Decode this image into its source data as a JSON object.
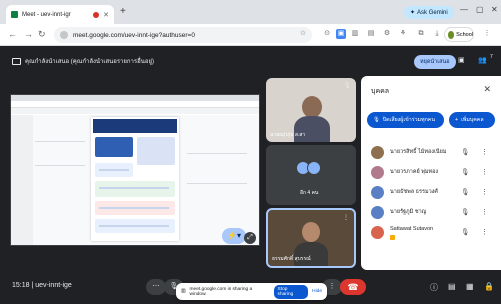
{
  "browser": {
    "tab_title": "Meet - uev-innt-igr",
    "new_tab": "+",
    "ask_gemini": "Ask Gemini",
    "url": "meet.google.com/uev-innt-ige?authuser=0",
    "profile_label": "School"
  },
  "meet": {
    "presenting_text": "คุณกำลังนำเสนอ (คุณกำลังนำเสนอรายการอื่นอยู่)",
    "stop_presenting": "หยุดนำเสนอ",
    "participant_count": "7",
    "tiles": [
      {
        "name": "นายณ(บ)บ ส.สา"
      },
      {
        "name": "อีก 4 คน"
      },
      {
        "name": "ธรรมศักดิ์ สุบรรณ์"
      }
    ],
    "time": "15:18",
    "meeting_code": "uev-innt-ige",
    "share_notice": "meet.google.com is sharing a window.",
    "stop_sharing": "Stop sharing",
    "hide": "Hide"
  },
  "panel": {
    "title": "บุคคล",
    "mute_all": "ปิดเสียงผู้เข้าร่วมทุกคน",
    "add_people": "เพิ่มบุคคล",
    "participants": [
      {
        "name": "นายวรสิทธิ์ ไม้ทองเนียม",
        "color": "#8e6f4f"
      },
      {
        "name": "นายวรภาคย์ พุ่มทอง",
        "color": "#b07a8c"
      },
      {
        "name": "นายธัชพล ธรรมวงศ์",
        "color": "#5a7fc4"
      },
      {
        "name": "นายรัฐภูมิ ชาญ",
        "color": "#5a7fc4"
      },
      {
        "name": "Sattawat Sutavon",
        "color": "#d9644d"
      }
    ]
  }
}
